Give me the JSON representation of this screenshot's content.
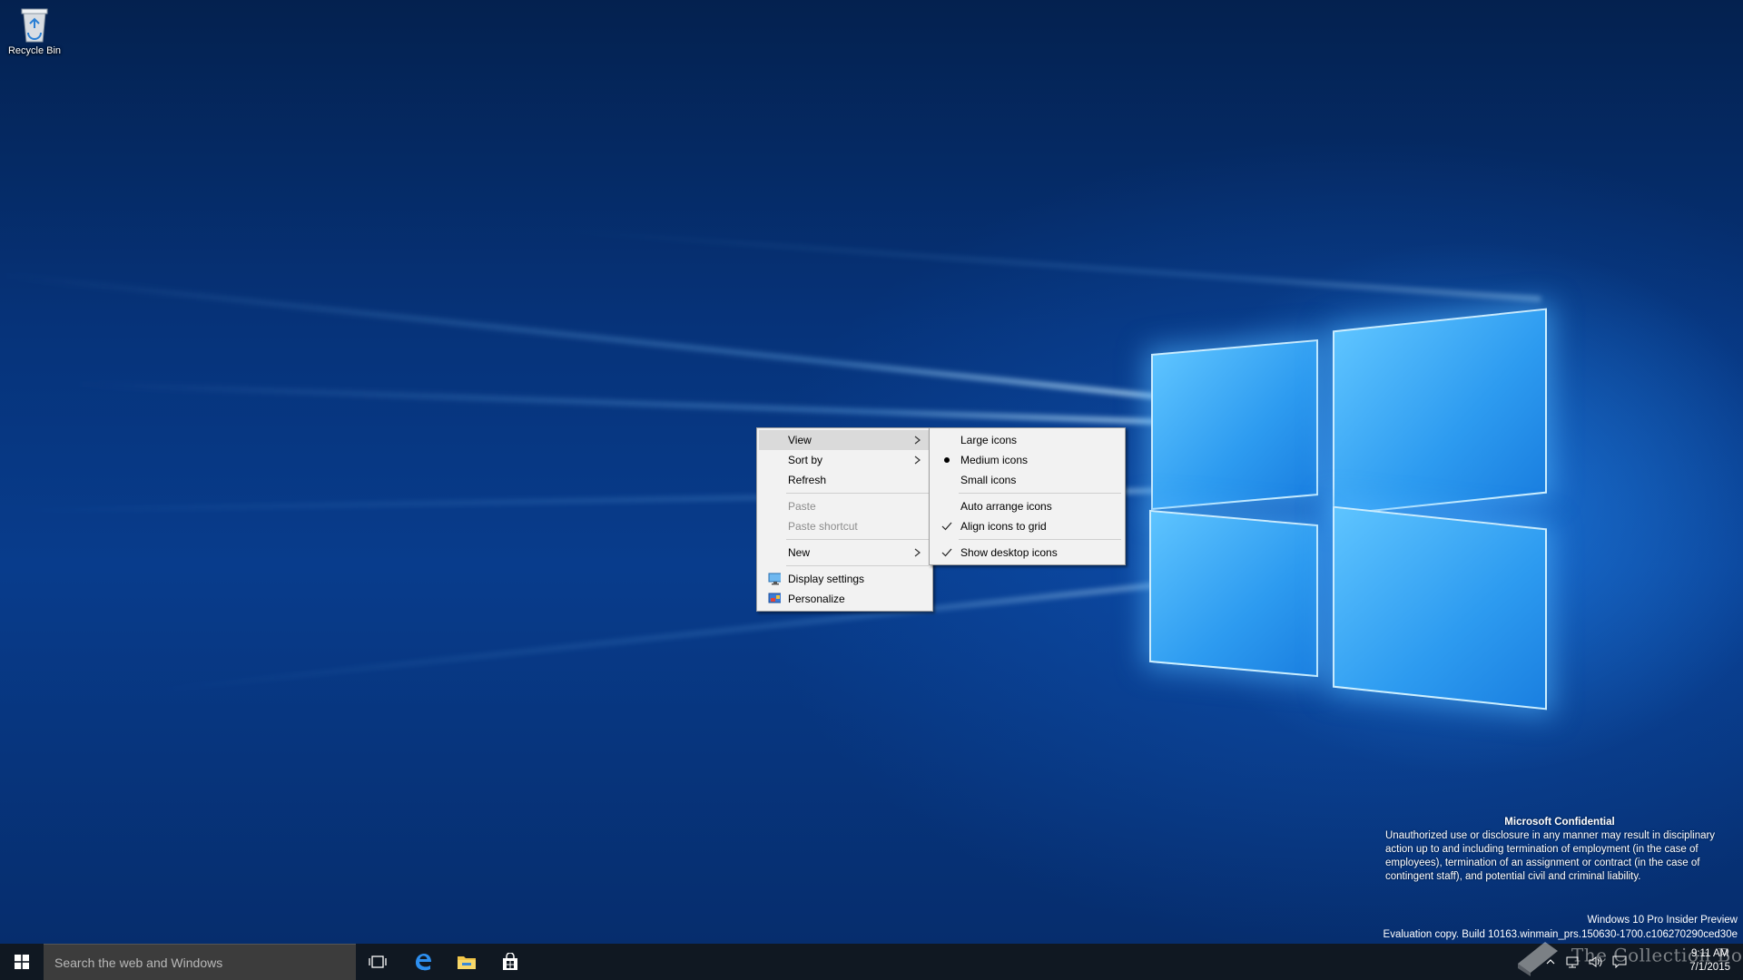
{
  "desktop": {
    "icons": [
      {
        "label": "Recycle Bin",
        "icon": "recycle-bin-icon"
      }
    ]
  },
  "context_menu": {
    "items": [
      {
        "label": "View",
        "has_submenu": true,
        "highlighted": true
      },
      {
        "label": "Sort by",
        "has_submenu": true
      },
      {
        "label": "Refresh"
      },
      {
        "label": "Paste",
        "disabled": true
      },
      {
        "label": "Paste shortcut",
        "disabled": true
      },
      {
        "label": "New",
        "has_submenu": true
      },
      {
        "label": "Display settings",
        "icon": "display-settings-icon"
      },
      {
        "label": "Personalize",
        "icon": "personalize-icon"
      }
    ]
  },
  "view_submenu": {
    "items": [
      {
        "label": "Large icons"
      },
      {
        "label": "Medium icons",
        "selected": "bullet"
      },
      {
        "label": "Small icons"
      },
      {
        "label": "Auto arrange icons"
      },
      {
        "label": "Align icons to grid",
        "checked": true
      },
      {
        "label": "Show desktop icons",
        "checked": true
      }
    ]
  },
  "notice": {
    "title": "Microsoft Confidential",
    "body": "Unauthorized use or disclosure in any manner may result in disciplinary action up to and including termination of employment (in the case of employees), termination of an assignment or contract (in the case of contingent staff), and potential civil and criminal liability.",
    "edition": "Windows 10 Pro Insider Preview",
    "build": "Evaluation copy. Build 10163.winmain_prs.150630-1700.c106270290ced30e"
  },
  "taskbar": {
    "search_placeholder": "Search the web and Windows",
    "pinned": [
      "task-view-icon",
      "edge-icon",
      "file-explorer-icon",
      "store-icon"
    ],
    "time": "9:11 AM",
    "date": "7/1/2015"
  },
  "watermark": "The Collection Book",
  "colors": {
    "taskbar": "#101822",
    "accent": "#1e88e5",
    "menu_bg": "#f2f2f2"
  }
}
